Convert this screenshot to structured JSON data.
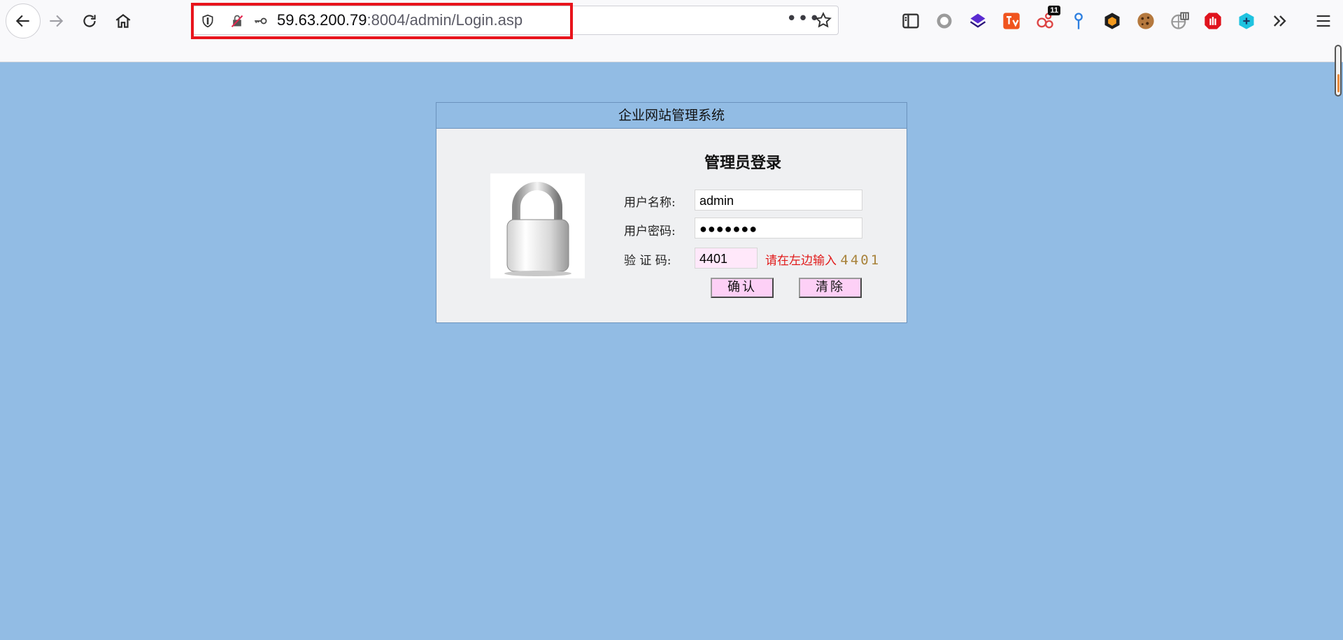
{
  "browser": {
    "url_host": "59.63.200.79",
    "url_rest": ":8004/admin/Login.asp",
    "extension_badge": "11",
    "colors": {
      "highlight": "#e8141c",
      "page_bg": "#92bce4"
    }
  },
  "login": {
    "system_title": "企业网站管理系统",
    "heading": "管理员登录",
    "username_label": "用户名称:",
    "username_value": "admin",
    "password_label": "用户密码:",
    "password_value": "●●●●●●●",
    "captcha_label": "验 证 码:",
    "captcha_value": "4401",
    "captcha_hint": "请在左边输入",
    "captcha_code": "4401",
    "confirm_button": "确认",
    "clear_button": "清除"
  }
}
